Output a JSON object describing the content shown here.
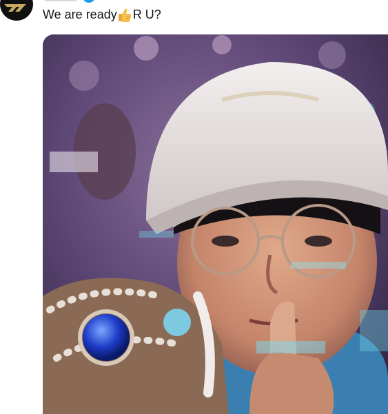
{
  "tweet": {
    "text_before_emoji": "We are ready",
    "emoji": "thumbs-up-emoji",
    "text_after_emoji": "R U?"
  },
  "author": {
    "avatar_icon": "t1-logo-icon",
    "verified_icon": "verified-badge-icon"
  },
  "media": {
    "kind": "photo",
    "subject": "person-in-white-cap-and-glasses-shush-gesture"
  },
  "colors": {
    "text": "#0f1419",
    "avatar_bg": "#101010",
    "logo": "#c8a860",
    "verified": "#1d9bf0"
  }
}
